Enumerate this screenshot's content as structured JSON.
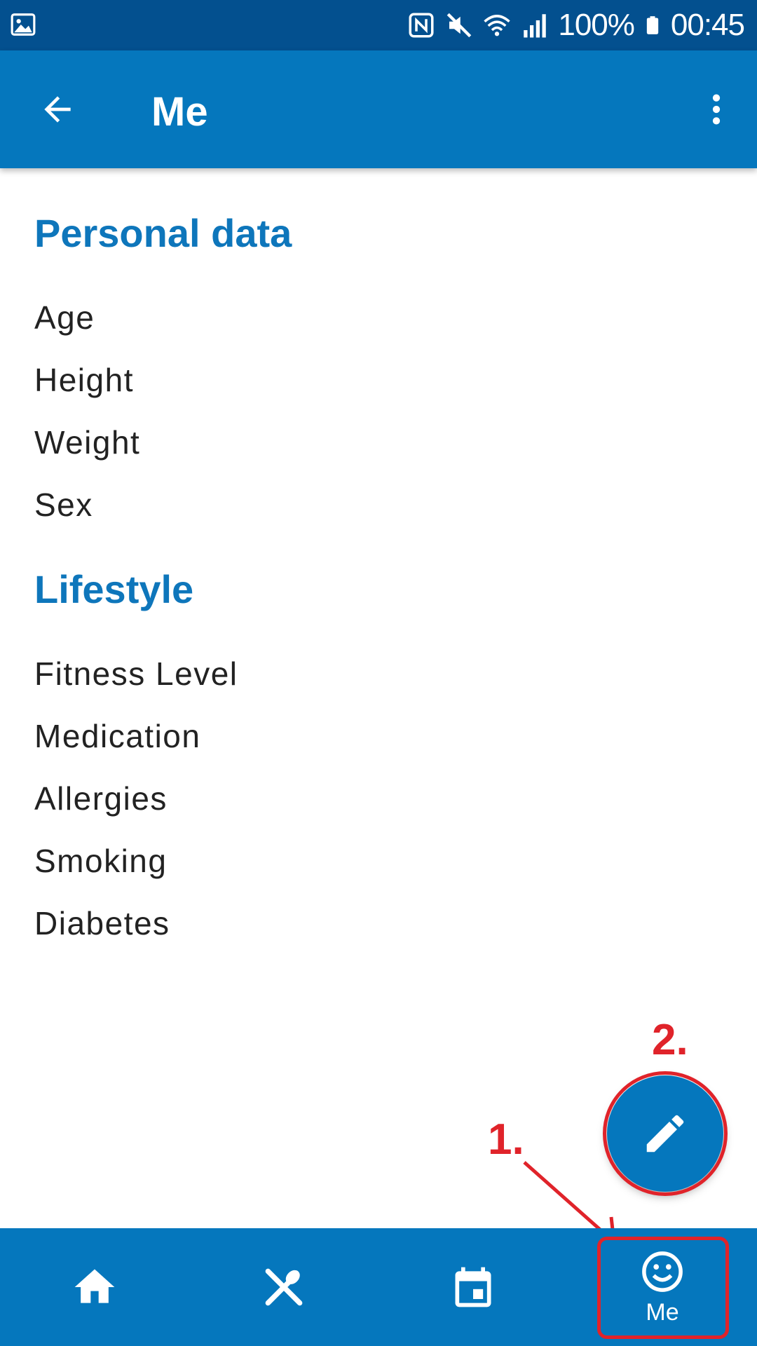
{
  "status_bar": {
    "battery_percent": "100%",
    "time": "00:45",
    "icons": [
      "gallery-icon",
      "nfc-icon",
      "mute-icon",
      "wifi-icon",
      "signal-icon",
      "battery-icon"
    ]
  },
  "app_bar": {
    "title": "Me",
    "icons": [
      "back-arrow-icon",
      "more-vert-icon"
    ]
  },
  "sections": [
    {
      "title": "Personal data",
      "items": [
        "Age",
        "Height",
        "Weight",
        "Sex"
      ]
    },
    {
      "title": "Lifestyle",
      "items": [
        "Fitness Level",
        "Medication",
        "Allergies",
        "Smoking",
        "Diabetes"
      ]
    }
  ],
  "fab": {
    "icon": "pencil-edit-icon"
  },
  "annotations": {
    "step1": "1.",
    "step2": "2."
  },
  "bottom_nav": {
    "items": [
      {
        "icon": "home-icon",
        "label": ""
      },
      {
        "icon": "utensils-icon",
        "label": ""
      },
      {
        "icon": "calendar-icon",
        "label": ""
      },
      {
        "icon": "smiley-face-icon",
        "label": "Me"
      }
    ]
  },
  "colors": {
    "status_bar": "#03508f",
    "primary": "#0577bd",
    "section_title": "#0e76bb",
    "annotation_red": "#e0232a"
  }
}
